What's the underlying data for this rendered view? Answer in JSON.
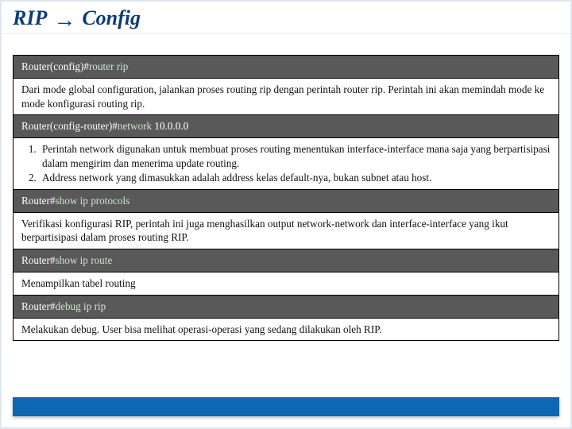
{
  "title": {
    "word1": "RIP",
    "word2": "Config"
  },
  "rows": {
    "r1": {
      "prompt": "Router(config)#",
      "cmd": "router rip"
    },
    "r2": "Dari mode global configuration, jalankan proses routing rip dengan perintah router rip. Perintah ini akan memindah mode ke mode konfigurasi routing rip.",
    "r3": {
      "prompt": "Router(config-router)#",
      "cmd": "network",
      "arg": " 10.0.0.0"
    },
    "r4": {
      "i1": "Perintah network digunakan untuk membuat proses routing menentukan interface-interface mana saja yang berpartisipasi dalam mengirim dan menerima update routing.",
      "i2": "Address network yang dimasukkan adalah address kelas default-nya, bukan subnet atau host."
    },
    "r5": {
      "prompt": "Router#",
      "cmd": "show ip protocols"
    },
    "r6": "Verifikasi konfigurasi RIP, perintah ini juga menghasilkan output network-network dan interface-interface yang ikut berpartisipasi dalam proses routing RIP.",
    "r7": {
      "prompt": "Router#",
      "cmd": "show ip route"
    },
    "r8": "Menampilkan tabel routing",
    "r9": {
      "prompt": "Router#",
      "cmd": "debug ip rip"
    },
    "r10": "Melakukan debug. User bisa melihat operasi-operasi yang sedang dilakukan oleh RIP."
  }
}
